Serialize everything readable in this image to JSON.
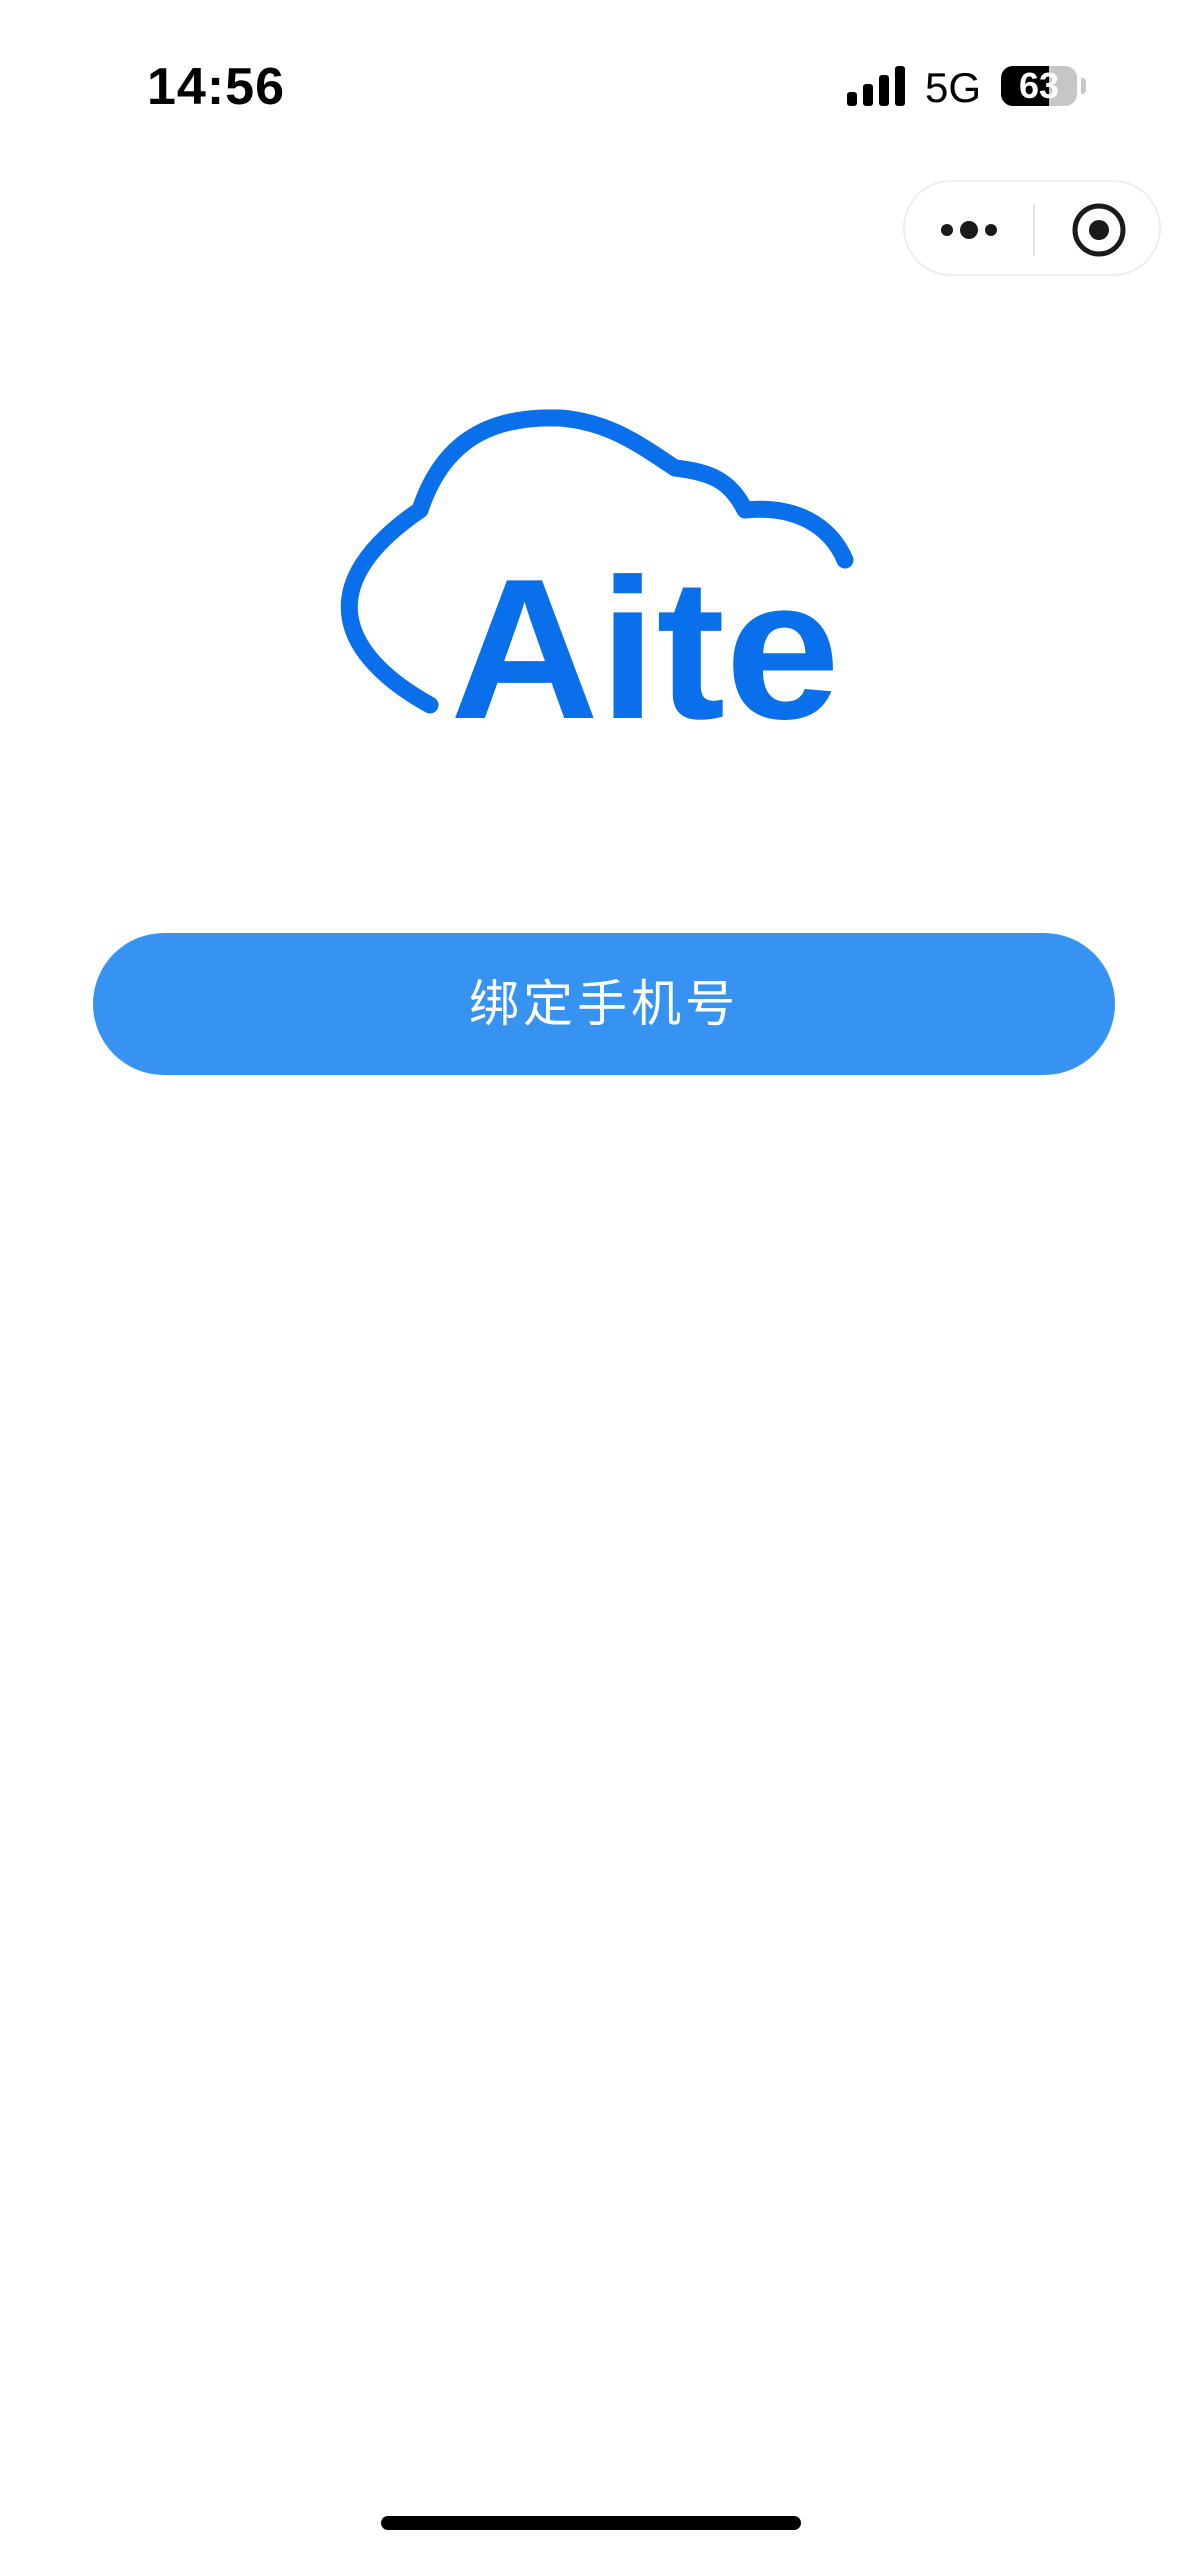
{
  "status_bar": {
    "time": "14:56",
    "network": "5G",
    "battery_level": "63",
    "battery_fraction": 0.63,
    "signal_icon": "cellular-signal-icon",
    "battery_icon": "battery-icon"
  },
  "capsule": {
    "more_icon": "more-dots-icon",
    "close_icon": "target-close-icon"
  },
  "logo": {
    "text": "Aite",
    "icon": "cloud-icon",
    "color": "#0a6fea"
  },
  "bind_button": {
    "label": "绑定手机号",
    "color": "#3793f2"
  }
}
